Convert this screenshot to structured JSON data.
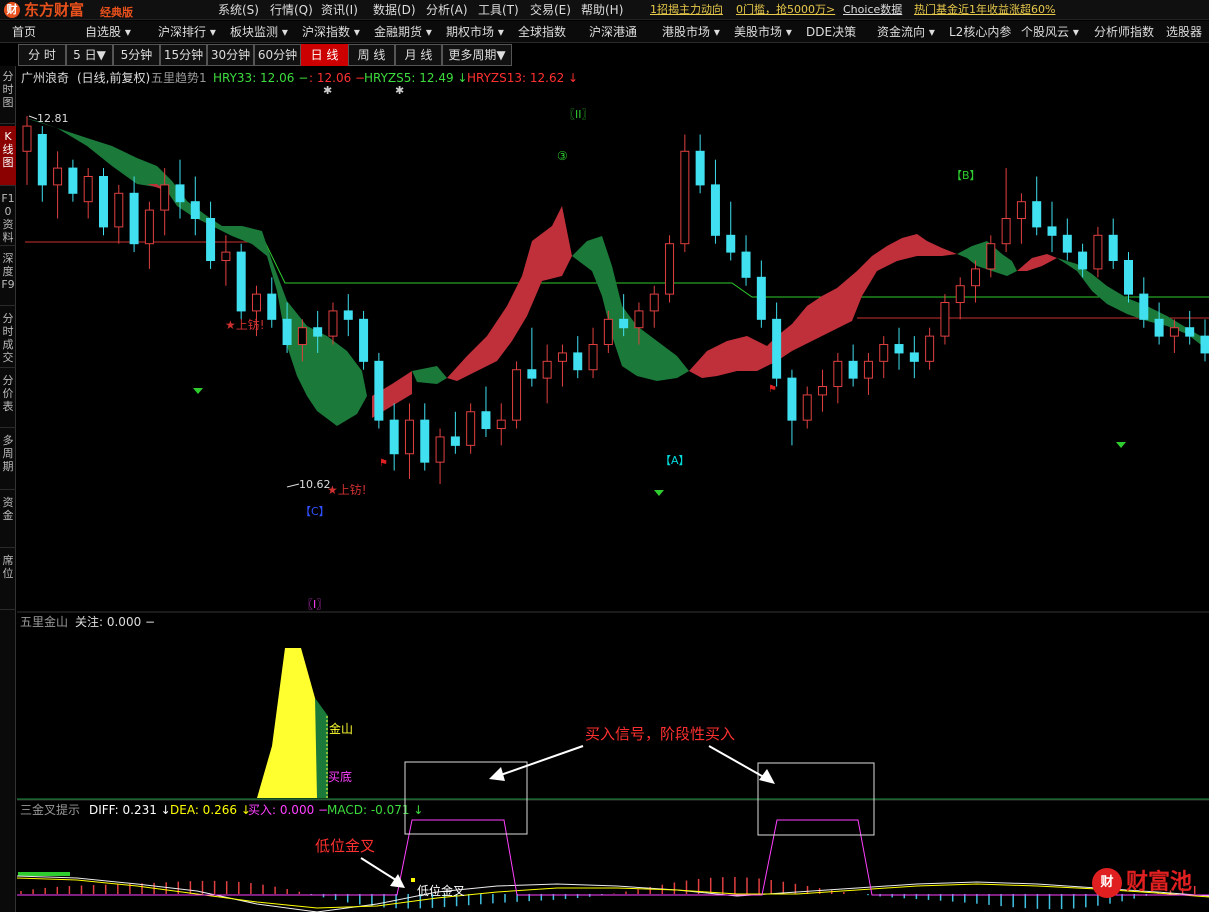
{
  "app": {
    "brand": "东方财富",
    "edition": "经典版",
    "brand_color": "#e8501c",
    "logo_glyph": "财"
  },
  "system_menu": [
    "系统(S)",
    "行情(Q)",
    "资讯(I)",
    "数据(D)",
    "分析(A)",
    "工具(T)",
    "交易(E)",
    "帮助(H)"
  ],
  "news_ticker": [
    {
      "text": "1招揭主力动向",
      "color": "#e6c84a"
    },
    {
      "text": "0门槛，抢5000万>",
      "color": "#e6c84a"
    },
    {
      "text": "Choice数据",
      "color": "#dddddd"
    },
    {
      "text": "热门基金近1年收益涨超60%",
      "color": "#e6c84a"
    }
  ],
  "nav": [
    "首页",
    "自选股 ▾",
    "沪深排行 ▾",
    "板块监测 ▾",
    "沪深指数 ▾",
    "金融期货 ▾",
    "期权市场 ▾",
    "全球指数",
    "沪深港通",
    "港股市场 ▾",
    "美股市场 ▾",
    "DDE决策",
    "资金流向 ▾",
    "L2核心内参",
    "个股风云 ▾",
    "分析师指数",
    "选股器"
  ],
  "periods": [
    {
      "label": "分 时",
      "active": false
    },
    {
      "label": "5 日▼",
      "active": false
    },
    {
      "label": "5分钟",
      "active": false
    },
    {
      "label": "15分钟",
      "active": false
    },
    {
      "label": "30分钟",
      "active": false
    },
    {
      "label": "60分钟",
      "active": false
    },
    {
      "label": "日 线",
      "active": true
    },
    {
      "label": "周 线",
      "active": false
    },
    {
      "label": "月 线",
      "active": false
    },
    {
      "label": "更多周期▼",
      "active": false
    }
  ],
  "sidebar": [
    {
      "label": "分时图",
      "active": false
    },
    {
      "label": "K线图",
      "active": true
    },
    {
      "label": "F10资料",
      "active": false
    },
    {
      "label": "深度F9",
      "active": false
    },
    {
      "label": "分时成交",
      "active": false
    },
    {
      "label": "分价表",
      "active": false
    },
    {
      "label": "多周期",
      "active": false
    },
    {
      "label": "资金",
      "active": false
    },
    {
      "label": "席位",
      "active": false
    }
  ],
  "main_panel": {
    "stock": "广州浪奇",
    "mode": "(日线,前复权)",
    "indicator": "五里趋势1",
    "legend": [
      {
        "text": "HRY33: 12.06 −",
        "color": "#3ddc3d"
      },
      {
        "text": ": 12.06 −",
        "color": "#ff3030"
      },
      {
        "text": "HRYZS5: 12.49 ↓",
        "color": "#3ddc3d"
      },
      {
        "text": "HRYZS13: 12.62 ↓",
        "color": "#ff3030"
      }
    ],
    "high_label": "12.81",
    "low_label": "10.62",
    "marks": {
      "ii": "〖II〗",
      "three": "③",
      "b": "【B】",
      "a": "【A】",
      "c": "【C】",
      "i": "〖I〗",
      "shangfang": "★上钫!"
    }
  },
  "sub1": {
    "title": "五里金山",
    "legend": "关注: 0.000 −",
    "label_jinshan": "金山",
    "label_maidi": "买底"
  },
  "sub2": {
    "title": "三金叉提示",
    "legend": [
      {
        "text": "DIFF: 0.231 ↓",
        "color": "#ffffff"
      },
      {
        "text": "DEA: 0.266 ↓",
        "color": "#ffff00"
      },
      {
        "text": "买入: 0.000 −",
        "color": "#ff40ff"
      },
      {
        "text": "MACD: -0.071 ↓",
        "color": "#3ddc3d"
      }
    ],
    "label_jincha": "低位金叉"
  },
  "annotations": {
    "buy_signal": "买入信号，阶段性买入",
    "low_cross": "低位金叉",
    "color": "#ff3030"
  },
  "watermark": {
    "glyph": "财",
    "text": "财富池"
  },
  "chart_data": {
    "type": "candlestick",
    "title": "广州浪奇 (日线,前复权)",
    "high": 12.81,
    "low": 10.62,
    "candles": [
      [
        12.6,
        12.81,
        12.4,
        12.75
      ],
      [
        12.7,
        12.75,
        12.3,
        12.4
      ],
      [
        12.4,
        12.6,
        12.2,
        12.5
      ],
      [
        12.5,
        12.55,
        12.3,
        12.35
      ],
      [
        12.3,
        12.5,
        12.2,
        12.45
      ],
      [
        12.45,
        12.5,
        12.1,
        12.15
      ],
      [
        12.15,
        12.4,
        12.05,
        12.35
      ],
      [
        12.35,
        12.45,
        12.0,
        12.05
      ],
      [
        12.05,
        12.3,
        11.9,
        12.25
      ],
      [
        12.25,
        12.5,
        12.1,
        12.4
      ],
      [
        12.4,
        12.55,
        12.2,
        12.3
      ],
      [
        12.3,
        12.45,
        12.1,
        12.2
      ],
      [
        12.2,
        12.3,
        11.9,
        11.95
      ],
      [
        11.95,
        12.1,
        11.8,
        12.0
      ],
      [
        12.0,
        12.05,
        11.6,
        11.65
      ],
      [
        11.65,
        11.8,
        11.5,
        11.75
      ],
      [
        11.75,
        11.85,
        11.55,
        11.6
      ],
      [
        11.6,
        11.7,
        11.4,
        11.45
      ],
      [
        11.45,
        11.6,
        11.35,
        11.55
      ],
      [
        11.55,
        11.65,
        11.4,
        11.5
      ],
      [
        11.5,
        11.7,
        11.45,
        11.65
      ],
      [
        11.65,
        11.75,
        11.5,
        11.6
      ],
      [
        11.6,
        11.65,
        11.3,
        11.35
      ],
      [
        11.35,
        11.4,
        10.95,
        11.0
      ],
      [
        11.0,
        11.1,
        10.7,
        10.8
      ],
      [
        10.8,
        11.1,
        10.65,
        11.0
      ],
      [
        11.0,
        11.1,
        10.7,
        10.75
      ],
      [
        10.75,
        10.95,
        10.62,
        10.9
      ],
      [
        10.9,
        11.05,
        10.8,
        10.85
      ],
      [
        10.85,
        11.1,
        10.8,
        11.05
      ],
      [
        11.05,
        11.2,
        10.9,
        10.95
      ],
      [
        10.95,
        11.1,
        10.85,
        11.0
      ],
      [
        11.0,
        11.35,
        10.95,
        11.3
      ],
      [
        11.3,
        11.55,
        11.2,
        11.25
      ],
      [
        11.25,
        11.45,
        11.1,
        11.35
      ],
      [
        11.35,
        11.45,
        11.2,
        11.4
      ],
      [
        11.4,
        11.5,
        11.25,
        11.3
      ],
      [
        11.3,
        11.55,
        11.25,
        11.45
      ],
      [
        11.45,
        11.65,
        11.4,
        11.6
      ],
      [
        11.6,
        11.75,
        11.5,
        11.55
      ],
      [
        11.55,
        11.7,
        11.45,
        11.65
      ],
      [
        11.65,
        11.8,
        11.55,
        11.75
      ],
      [
        11.75,
        12.1,
        11.7,
        12.05
      ],
      [
        12.05,
        12.7,
        12.0,
        12.6
      ],
      [
        12.6,
        12.7,
        12.35,
        12.4
      ],
      [
        12.4,
        12.55,
        12.05,
        12.1
      ],
      [
        12.1,
        12.3,
        11.95,
        12.0
      ],
      [
        12.0,
        12.1,
        11.8,
        11.85
      ],
      [
        11.85,
        11.95,
        11.55,
        11.6
      ],
      [
        11.6,
        11.7,
        11.2,
        11.25
      ],
      [
        11.25,
        11.3,
        10.85,
        11.0
      ],
      [
        11.0,
        11.2,
        10.95,
        11.15
      ],
      [
        11.15,
        11.3,
        11.05,
        11.2
      ],
      [
        11.2,
        11.4,
        11.1,
        11.35
      ],
      [
        11.35,
        11.45,
        11.2,
        11.25
      ],
      [
        11.25,
        11.4,
        11.15,
        11.35
      ],
      [
        11.35,
        11.5,
        11.25,
        11.45
      ],
      [
        11.45,
        11.55,
        11.3,
        11.4
      ],
      [
        11.4,
        11.5,
        11.25,
        11.35
      ],
      [
        11.35,
        11.55,
        11.3,
        11.5
      ],
      [
        11.5,
        11.75,
        11.45,
        11.7
      ],
      [
        11.7,
        11.85,
        11.6,
        11.8
      ],
      [
        11.8,
        11.95,
        11.7,
        11.9
      ],
      [
        11.9,
        12.1,
        11.85,
        12.05
      ],
      [
        12.05,
        12.5,
        12.0,
        12.2
      ],
      [
        12.2,
        12.35,
        12.05,
        12.3
      ],
      [
        12.3,
        12.45,
        12.1,
        12.15
      ],
      [
        12.15,
        12.3,
        12.0,
        12.1
      ],
      [
        12.1,
        12.2,
        11.95,
        12.0
      ],
      [
        12.0,
        12.05,
        11.85,
        11.9
      ],
      [
        11.9,
        12.15,
        11.85,
        12.1
      ],
      [
        12.1,
        12.2,
        11.9,
        11.95
      ],
      [
        11.95,
        12.0,
        11.7,
        11.75
      ],
      [
        11.75,
        11.85,
        11.55,
        11.6
      ],
      [
        11.6,
        11.7,
        11.45,
        11.5
      ],
      [
        11.5,
        11.6,
        11.4,
        11.55
      ],
      [
        11.55,
        11.65,
        11.45,
        11.5
      ],
      [
        11.5,
        11.6,
        11.35,
        11.4
      ]
    ]
  }
}
